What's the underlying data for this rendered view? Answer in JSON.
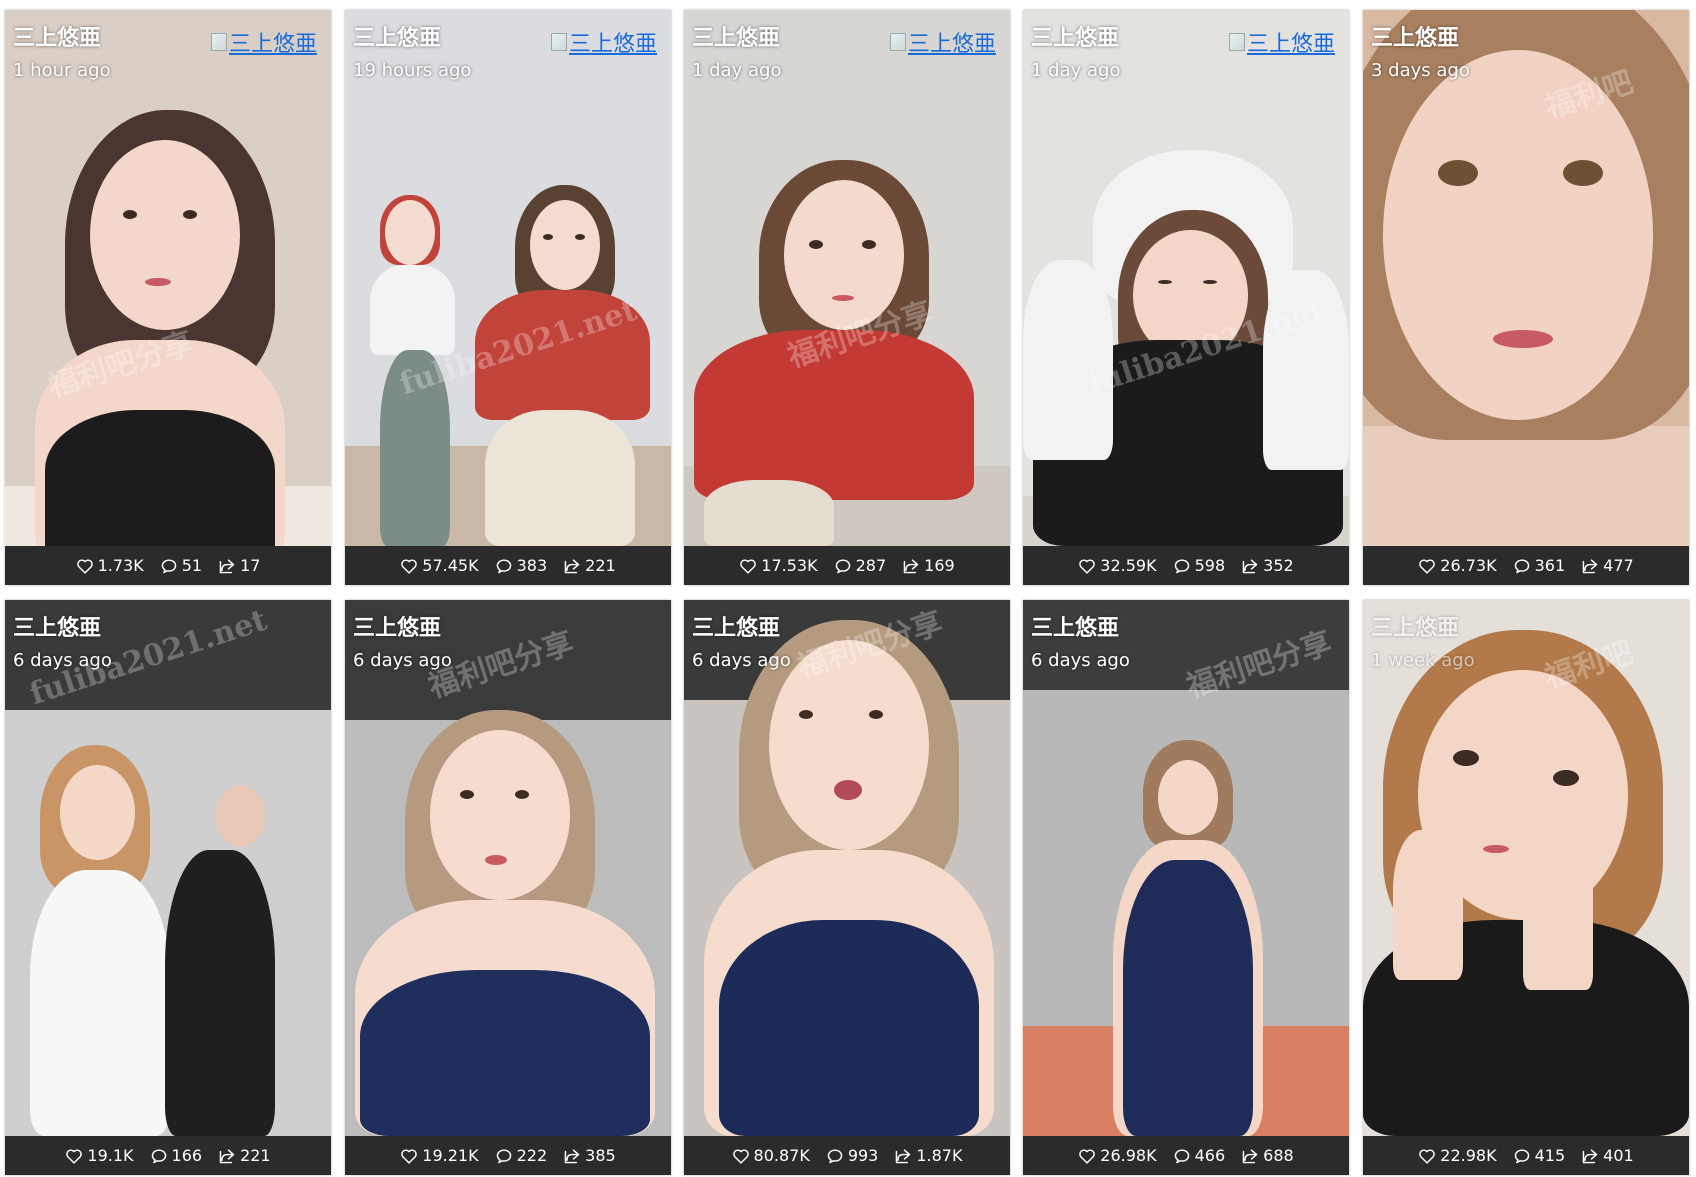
{
  "cards": [
    {
      "author": "三上悠亜",
      "time": "1 hour ago",
      "avatar_alt": "三上悠亜",
      "likes": "1.73K",
      "comments": "51",
      "shares": "17",
      "wall": "#d9cfc6",
      "floor": "#efe8e0",
      "hair": "#4a3530",
      "skin": "#f3d7cb",
      "outfit": "#1c1c1c"
    },
    {
      "author": "三上悠亜",
      "time": "19 hours ago",
      "avatar_alt": "三上悠亜",
      "likes": "57.45K",
      "comments": "383",
      "shares": "221",
      "wall": "#dadcdf",
      "floor": "#c9b8a6",
      "hair": "#5a4233",
      "skin": "#f4dcd0",
      "outfit": "#c2433a"
    },
    {
      "author": "三上悠亜",
      "time": "1 day ago",
      "avatar_alt": "三上悠亜",
      "likes": "17.53K",
      "comments": "287",
      "shares": "169",
      "wall": "#d8d6d3",
      "floor": "#cfc8c0",
      "hair": "#6a4a36",
      "skin": "#f4dacd",
      "outfit": "#c23a33"
    },
    {
      "author": "三上悠亜",
      "time": "1 day ago",
      "avatar_alt": "三上悠亜",
      "likes": "32.59K",
      "comments": "598",
      "shares": "352",
      "wall": "#e4e2de",
      "floor": "#d6d2cc",
      "hair": "#6b4a3a",
      "skin": "#f3d6c8",
      "outfit": "#f2f2f2"
    },
    {
      "author": "三上悠亜",
      "time": "3 days ago",
      "avatar_alt": "",
      "likes": "26.73K",
      "comments": "361",
      "shares": "477",
      "wall": "#d9b8a2",
      "floor": "#e8cdbd",
      "hair": "#a8805f",
      "skin": "#f2d2c2",
      "outfit": "#e9c8b8"
    },
    {
      "author": "三上悠亜",
      "time": "6 days ago",
      "avatar_alt": "",
      "likes": "19.1K",
      "comments": "166",
      "shares": "221",
      "wall": "#cfcfcf",
      "floor": "#3a3a3a",
      "hair": "#c99566",
      "skin": "#f4d8c7",
      "outfit": "#f7f7f7"
    },
    {
      "author": "三上悠亜",
      "time": "6 days ago",
      "avatar_alt": "",
      "likes": "19.21K",
      "comments": "222",
      "shares": "385",
      "wall": "#bcbcbc",
      "floor": "#d9d4cf",
      "hair": "#b59a80",
      "skin": "#f5dccf",
      "outfit": "#1f2e5c"
    },
    {
      "author": "三上悠亜",
      "time": "6 days ago",
      "avatar_alt": "",
      "likes": "80.87K",
      "comments": "993",
      "shares": "1.87K",
      "wall": "#c9c4bf",
      "floor": "#e0dbd6",
      "hair": "#b49a7e",
      "skin": "#f5dccd",
      "outfit": "#1d2b58"
    },
    {
      "author": "三上悠亜",
      "time": "6 days ago",
      "avatar_alt": "",
      "likes": "26.98K",
      "comments": "466",
      "shares": "688",
      "wall": "#b8b8b8",
      "floor": "#d87f64",
      "hair": "#a07b5d",
      "skin": "#f4d7c7",
      "outfit": "#1f2c5a"
    },
    {
      "author": "三上悠亜",
      "time": "1 week ago",
      "avatar_alt": "",
      "likes": "22.98K",
      "comments": "415",
      "shares": "401",
      "wall": "#e5dfda",
      "floor": "#d8cfc8",
      "hair": "#b27a4a",
      "skin": "#f4d6c6",
      "outfit": "#1a1a1a"
    }
  ],
  "icons": {
    "like": "heart-icon",
    "comment": "comment-icon",
    "share": "share-icon"
  }
}
